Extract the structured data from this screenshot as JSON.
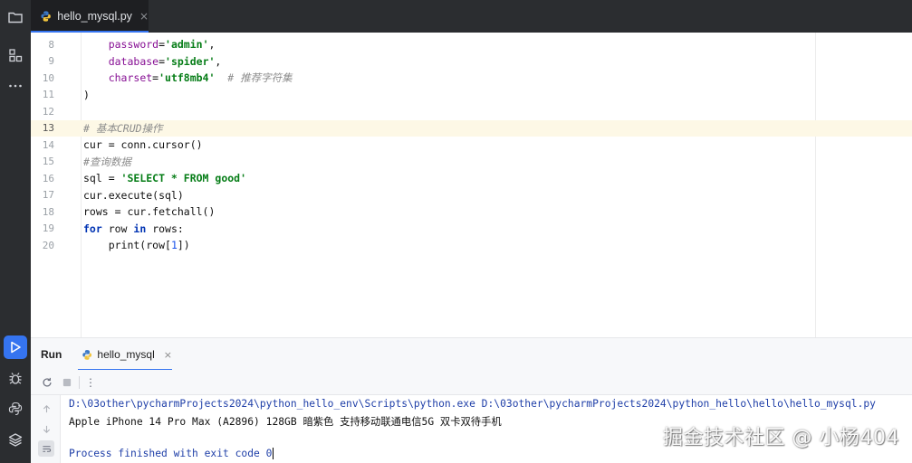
{
  "editor": {
    "tab": {
      "filename": "hello_mysql.py",
      "close_glyph": "×"
    },
    "lines": [
      {
        "num": "8",
        "tokens": [
          {
            "t": "    ",
            "c": ""
          },
          {
            "t": "password",
            "c": "param"
          },
          {
            "t": "=",
            "c": ""
          },
          {
            "t": "'admin'",
            "c": "str"
          },
          {
            "t": ",",
            "c": ""
          }
        ]
      },
      {
        "num": "9",
        "tokens": [
          {
            "t": "    ",
            "c": ""
          },
          {
            "t": "database",
            "c": "param"
          },
          {
            "t": "=",
            "c": ""
          },
          {
            "t": "'spider'",
            "c": "str"
          },
          {
            "t": ",",
            "c": ""
          }
        ]
      },
      {
        "num": "10",
        "tokens": [
          {
            "t": "    ",
            "c": ""
          },
          {
            "t": "charset",
            "c": "param"
          },
          {
            "t": "=",
            "c": ""
          },
          {
            "t": "'utf8mb4'",
            "c": "str"
          },
          {
            "t": "  ",
            "c": ""
          },
          {
            "t": "# 推荐字符集",
            "c": "cmt"
          }
        ]
      },
      {
        "num": "11",
        "tokens": [
          {
            "t": ")",
            "c": ""
          }
        ]
      },
      {
        "num": "12",
        "tokens": []
      },
      {
        "num": "13",
        "tokens": [
          {
            "t": "# 基本CRUD操作",
            "c": "cmt"
          }
        ]
      },
      {
        "num": "14",
        "tokens": [
          {
            "t": "cur = conn.cursor()",
            "c": ""
          }
        ]
      },
      {
        "num": "15",
        "tokens": [
          {
            "t": "#查询数据",
            "c": "cmt"
          }
        ]
      },
      {
        "num": "16",
        "tokens": [
          {
            "t": "sql = ",
            "c": ""
          },
          {
            "t": "'SELECT * FROM good'",
            "c": "str"
          }
        ]
      },
      {
        "num": "17",
        "tokens": [
          {
            "t": "cur.execute(sql)",
            "c": ""
          }
        ]
      },
      {
        "num": "18",
        "tokens": [
          {
            "t": "rows = cur.fetchall()",
            "c": ""
          }
        ]
      },
      {
        "num": "19",
        "tokens": [
          {
            "t": "for",
            "c": "kw"
          },
          {
            "t": " row ",
            "c": ""
          },
          {
            "t": "in",
            "c": "kw"
          },
          {
            "t": " rows:",
            "c": ""
          }
        ]
      },
      {
        "num": "20",
        "tokens": [
          {
            "t": "    print(row[",
            "c": ""
          },
          {
            "t": "1",
            "c": "num"
          },
          {
            "t": "])",
            "c": ""
          }
        ]
      }
    ],
    "highlighted_line": "13"
  },
  "run_panel": {
    "title": "Run",
    "tab_label": "hello_mysql",
    "close_glyph": "×",
    "more_glyph": "⋮"
  },
  "console": {
    "lines": [
      {
        "text": "D:\\03other\\pycharmProjects2024\\python_hello_env\\Scripts\\python.exe D:\\03other\\pycharmProjects2024\\python_hello\\hello\\hello_mysql.py",
        "kind": "cmd"
      },
      {
        "text": "Apple iPhone 14 Pro Max (A2896) 128GB 暗紫色 支持移动联通电信5G 双卡双待手机",
        "kind": "out"
      },
      {
        "text": "",
        "kind": "out"
      },
      {
        "text": "Process finished with exit code 0",
        "kind": "cmd"
      }
    ]
  },
  "watermark": "掘金技术社区 @ 小杨404",
  "icons": {
    "activity": [
      "folder-icon",
      "structure-icon",
      "more-icon",
      "run-icon",
      "debug-icon",
      "python-console-icon",
      "layers-icon"
    ],
    "toolbar": [
      "rerun-icon",
      "stop-icon",
      "more-options-icon"
    ],
    "console_gutter": [
      "scroll-up-icon",
      "scroll-down-icon",
      "soft-wrap-icon"
    ]
  },
  "colors": {
    "accent": "#3574f0",
    "dark_bar": "#2b2d30",
    "keyword": "#0033b3",
    "string": "#067d17",
    "parameter": "#871094",
    "comment": "#8c8c8c",
    "number": "#1750eb",
    "console_cmd": "#1f3fa8",
    "highlight_line": "#fdf8e6"
  }
}
